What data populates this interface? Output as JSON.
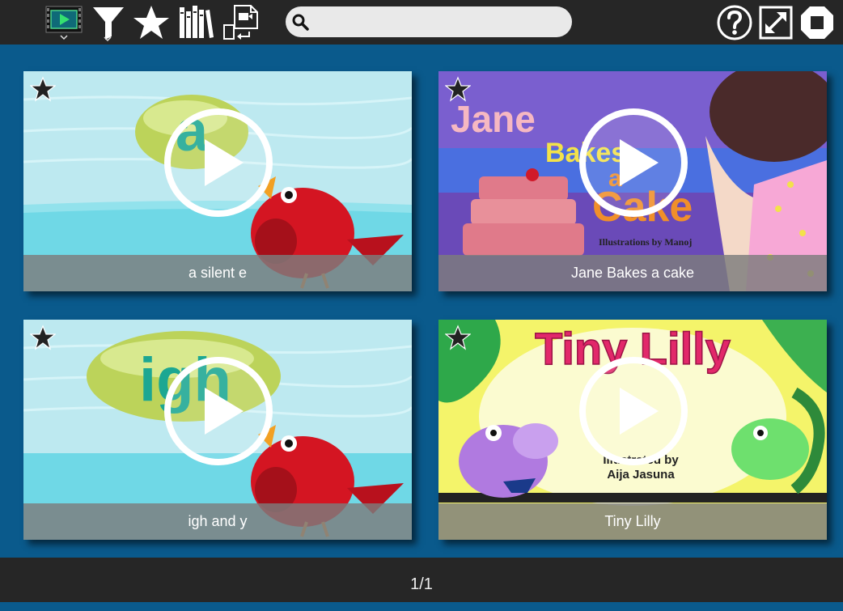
{
  "toolbar": {
    "icons": [
      "video-library-icon",
      "filter-icon",
      "favorites-star-icon",
      "bookshelf-icon",
      "import-export-icon"
    ],
    "search": {
      "placeholder": "",
      "value": ""
    },
    "right_icons": [
      "help-icon",
      "fullscreen-icon",
      "stop-icon"
    ]
  },
  "videos": [
    {
      "title": "a silent e"
    },
    {
      "title": "Jane Bakes a cake",
      "thumb_text": [
        "Jane",
        "Bakes",
        "a",
        "Cake",
        "Illustrations by Manoj"
      ]
    },
    {
      "title": "igh and y"
    },
    {
      "title": "Tiny Lilly",
      "thumb_text": [
        "Tiny Lilly",
        "Illustrated by",
        "Aija Jasuna"
      ]
    }
  ],
  "thumb_letters": {
    "card1": "a",
    "card3": "igh"
  },
  "pagination": {
    "label": "1/1"
  },
  "colors": {
    "toolbar": "#262626",
    "page_background": "#0a5a8c",
    "caption_overlay": "#7d7d7d"
  }
}
